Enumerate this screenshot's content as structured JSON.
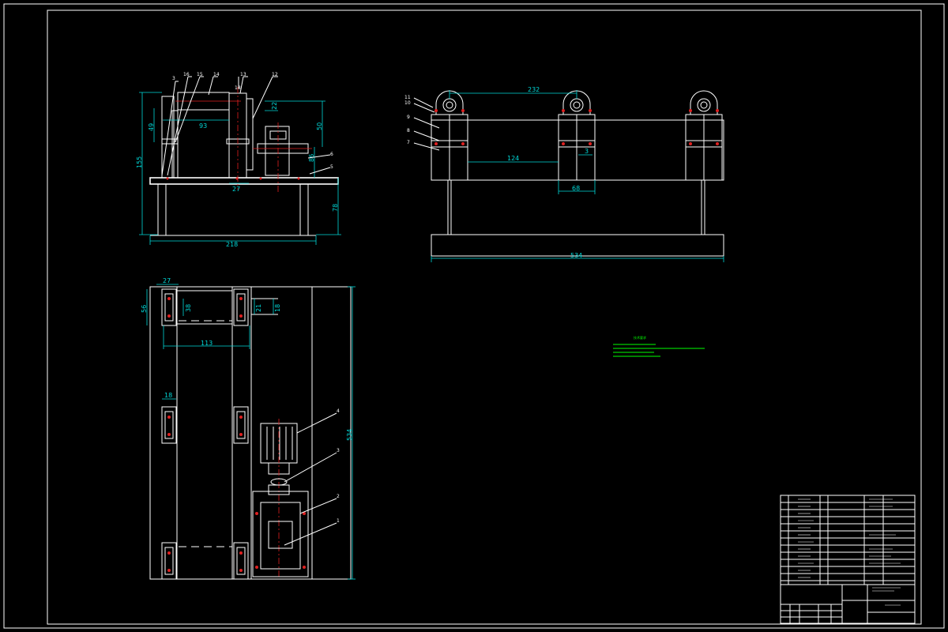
{
  "drawing": {
    "colors": {
      "background": "#000000",
      "outline": "#ffffff",
      "dimension": "#00d8d8",
      "centerline": "#e02020",
      "note": "#00ff00"
    },
    "side_view": {
      "dims": {
        "total_height": "155",
        "upper": "49",
        "width_93": "93",
        "boss": "27",
        "base_height": "78",
        "total_width": "218",
        "right_22": "22",
        "right_50": "50",
        "right_86": "86"
      },
      "balloons": [
        "3",
        "16",
        "15",
        "14",
        "13",
        "18",
        "12",
        "6",
        "5"
      ]
    },
    "front_view": {
      "dims": {
        "pitch": "232",
        "inner": "124",
        "offset": "3",
        "block": "68",
        "total": "534"
      },
      "balloons": [
        "11",
        "10",
        "9",
        "8",
        "7"
      ]
    },
    "top_view": {
      "dims": {
        "top_27": "27",
        "left_56": "56",
        "h_38": "38",
        "h_113": "113",
        "h_18": "18",
        "h_21": "21",
        "h_18b": "18",
        "total_534": "534"
      },
      "balloons": [
        "4",
        "3",
        "2",
        "1"
      ]
    },
    "notes": {
      "title": "技术要求"
    }
  }
}
